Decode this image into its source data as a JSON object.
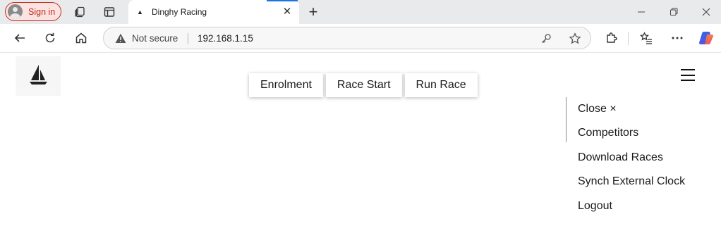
{
  "browser": {
    "signin_label": "Sign in",
    "tab_title": "Dinghy Racing",
    "tab_favicon": "▲",
    "tab_close": "✕",
    "new_tab": "+",
    "security_label": "Not secure",
    "url": "192.168.1.15"
  },
  "nav": {
    "items": [
      {
        "label": "Enrolment"
      },
      {
        "label": "Race Start"
      },
      {
        "label": "Run Race"
      }
    ]
  },
  "menu": {
    "close_label": "Close ×",
    "items": [
      {
        "label": "Competitors"
      },
      {
        "label": "Download Races"
      },
      {
        "label": "Synch External Clock"
      },
      {
        "label": "Logout"
      }
    ]
  },
  "icons": {
    "logo": "sailboat-icon",
    "menu": "hamburger-icon"
  }
}
